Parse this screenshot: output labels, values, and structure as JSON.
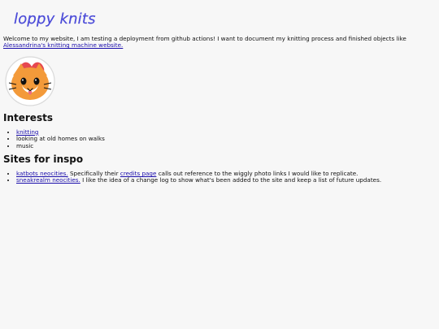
{
  "header": {
    "logo_text": "loppy knits"
  },
  "intro": {
    "text_before_link": "Welcome to my website, I am testing a deployment from github actions! I want to document my knitting process and finished objects like ",
    "link_text": "Alessandrina's knitting machine website."
  },
  "sections": {
    "interests": {
      "title": "Interests",
      "items": [
        {
          "label": "knitting",
          "is_link": true
        },
        {
          "label": "looking at old homes on walks",
          "is_link": false
        },
        {
          "label": "music",
          "is_link": false
        }
      ]
    },
    "sites": {
      "title": "Sites for inspo",
      "item1": {
        "link_text": "katbots neocities.",
        "text_before_link": " Specifically their ",
        "link2_text": "credits page",
        "text_after_link": " calls out reference to the wiggly photo links I would like to replicate."
      },
      "item2": {
        "link_text": "sneakrealm neocities.",
        "text_after_link": " I like the idea of a change log to show what's been added to the site and keep a list of future updates."
      }
    }
  },
  "colors": {
    "background": "#f7f7f7",
    "link": "#1a0dab",
    "text": "#111111",
    "logo": "#4b4bd8",
    "cat_orange": "#f39a3a",
    "cat_white": "#ffffff",
    "heart": "#e3343d",
    "mouth": "#ea6a86"
  },
  "icons": {
    "header": "loppy-knits-wordmark",
    "hero": "cat-face-sticker-with-heart"
  }
}
